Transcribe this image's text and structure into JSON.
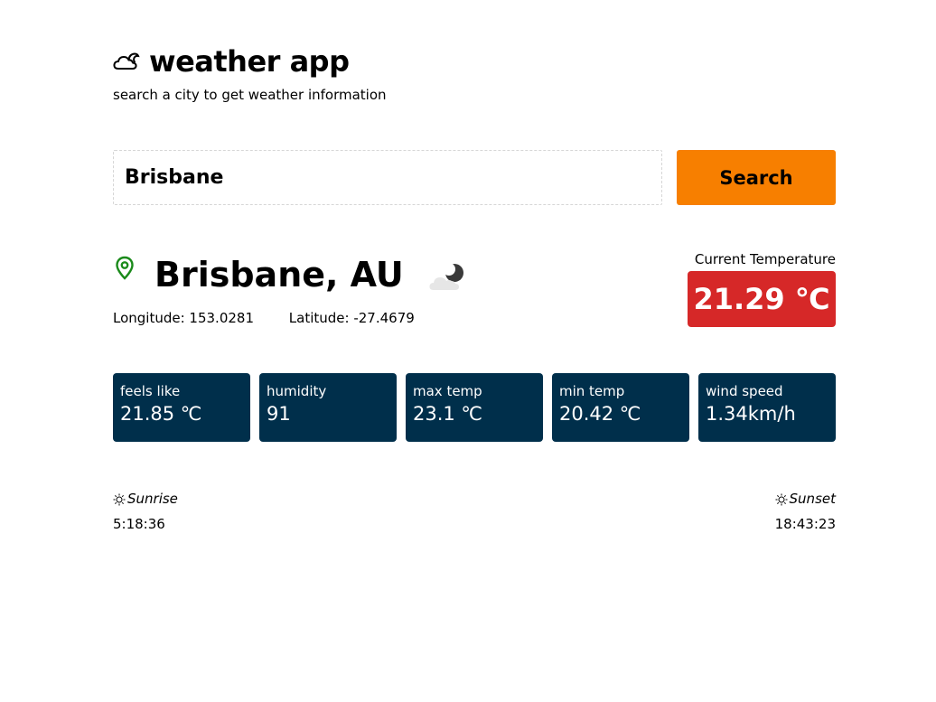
{
  "app": {
    "title": "weather app",
    "subtitle": "search a city to get weather information"
  },
  "search": {
    "value": "Brisbane",
    "button_label": "Search"
  },
  "location": {
    "city": "Brisbane, AU",
    "longitude_text": "Longitude: 153.0281",
    "latitude_text": "Latitude: -27.4679",
    "condition_icon": "cloudy-night-icon"
  },
  "current": {
    "label": "Current Temperature",
    "value": "21.29 ℃",
    "color": "#d62828"
  },
  "stats": [
    {
      "label": "feels like",
      "value": "21.85 ℃"
    },
    {
      "label": "humidity",
      "value": "91"
    },
    {
      "label": "max temp",
      "value": "23.1 ℃"
    },
    {
      "label": "min temp",
      "value": "20.42 ℃"
    },
    {
      "label": "wind speed",
      "value": "1.34km/h"
    }
  ],
  "sun": {
    "sunrise_label": "Sunrise",
    "sunrise_time": "5:18:36",
    "sunset_label": "Sunset",
    "sunset_time": "18:43:23"
  },
  "colors": {
    "accent_button": "#f77f00",
    "card_bg": "#002f4b",
    "pin": "#1a8a1a"
  }
}
